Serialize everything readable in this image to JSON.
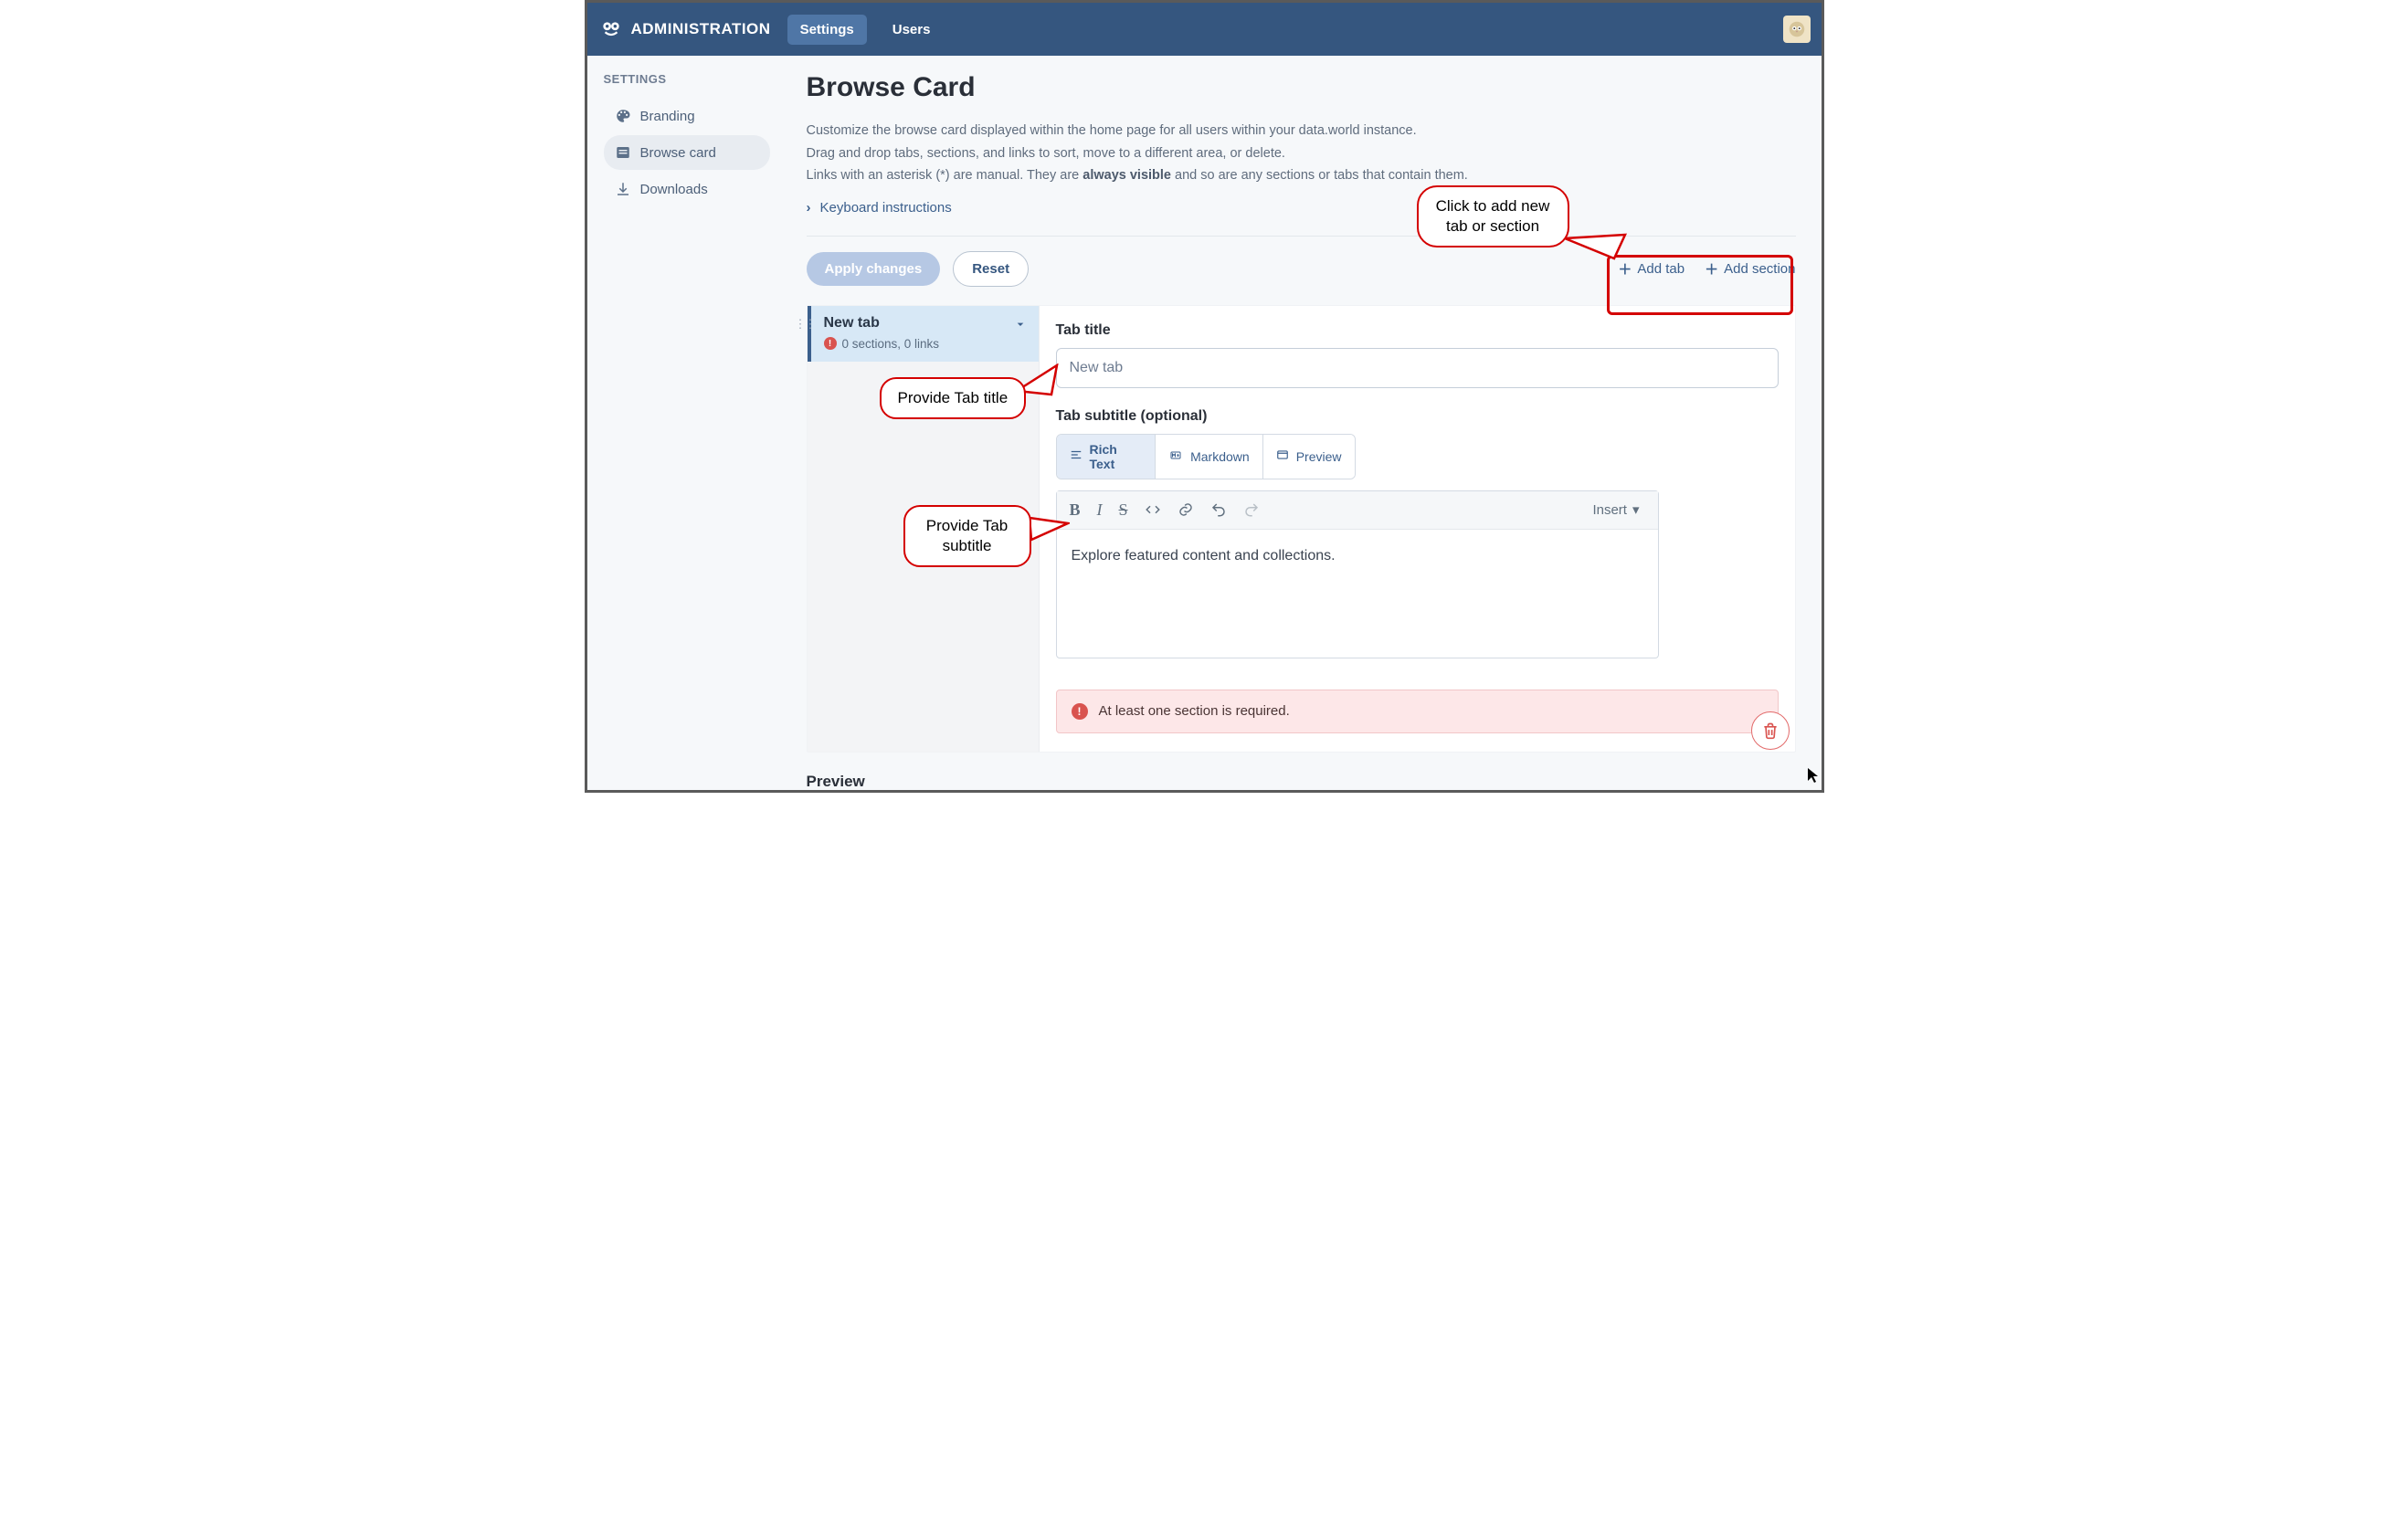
{
  "topnav": {
    "title": "ADMINISTRATION",
    "tabs": {
      "settings": "Settings",
      "users": "Users"
    }
  },
  "sidebar": {
    "title": "SETTINGS",
    "items": [
      {
        "label": "Branding"
      },
      {
        "label": "Browse card"
      },
      {
        "label": "Downloads"
      }
    ]
  },
  "page": {
    "title": "Browse Card",
    "descr_line1": "Customize the browse card displayed within the home page for all users within your data.world instance.",
    "descr_line2": "Drag and drop tabs, sections, and links to sort, move to a different area, or delete.",
    "descr_line3_a": "Links with an asterisk (*) are manual. They are ",
    "descr_line3_strong": "always visible",
    "descr_line3_b": " and so are any sections or tabs that contain them.",
    "keyboard": "Keyboard instructions",
    "apply": "Apply changes",
    "reset": "Reset",
    "add_tab": "Add tab",
    "add_section": "Add section",
    "preview": "Preview"
  },
  "tab_panel": {
    "name": "New tab",
    "meta": "0 sections, 0 links"
  },
  "form": {
    "tab_title_label": "Tab title",
    "tab_title_value": "New tab",
    "subtitle_label": "Tab subtitle (optional)",
    "modes": {
      "rich": "Rich Text",
      "md": "Markdown",
      "preview": "Preview"
    },
    "insert": "Insert",
    "body": "Explore featured content and collections.",
    "error": "At least one section is required."
  },
  "callouts": {
    "top": "Click to add new tab or section",
    "title": "Provide Tab title",
    "subtitle": "Provide Tab subtitle"
  }
}
